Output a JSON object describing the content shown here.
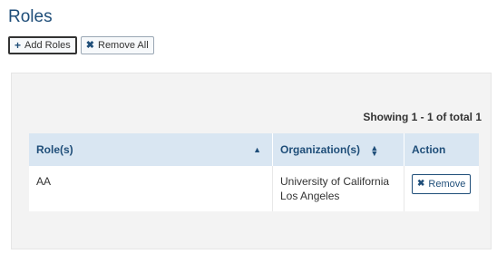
{
  "page": {
    "title": "Roles"
  },
  "toolbar": {
    "add_roles_label": "Add Roles",
    "remove_all_label": "Remove All"
  },
  "panel": {
    "showing_text": "Showing 1 - 1 of total 1"
  },
  "table": {
    "headers": {
      "roles": "Role(s)",
      "organizations": "Organization(s)",
      "action": "Action"
    },
    "rows": [
      {
        "role": "AA",
        "organization": "University of California Los Angeles",
        "action_label": "Remove"
      }
    ]
  },
  "icons": {
    "add": "plus-icon",
    "remove_all": "close-icon",
    "row_remove": "close-icon",
    "sort_asc": "sort-up-icon",
    "sort_both": "sort-both-icon"
  },
  "colors": {
    "title": "#1f4e79",
    "header_bg": "#d9e6f2",
    "panel_bg": "#f3f3f3"
  }
}
